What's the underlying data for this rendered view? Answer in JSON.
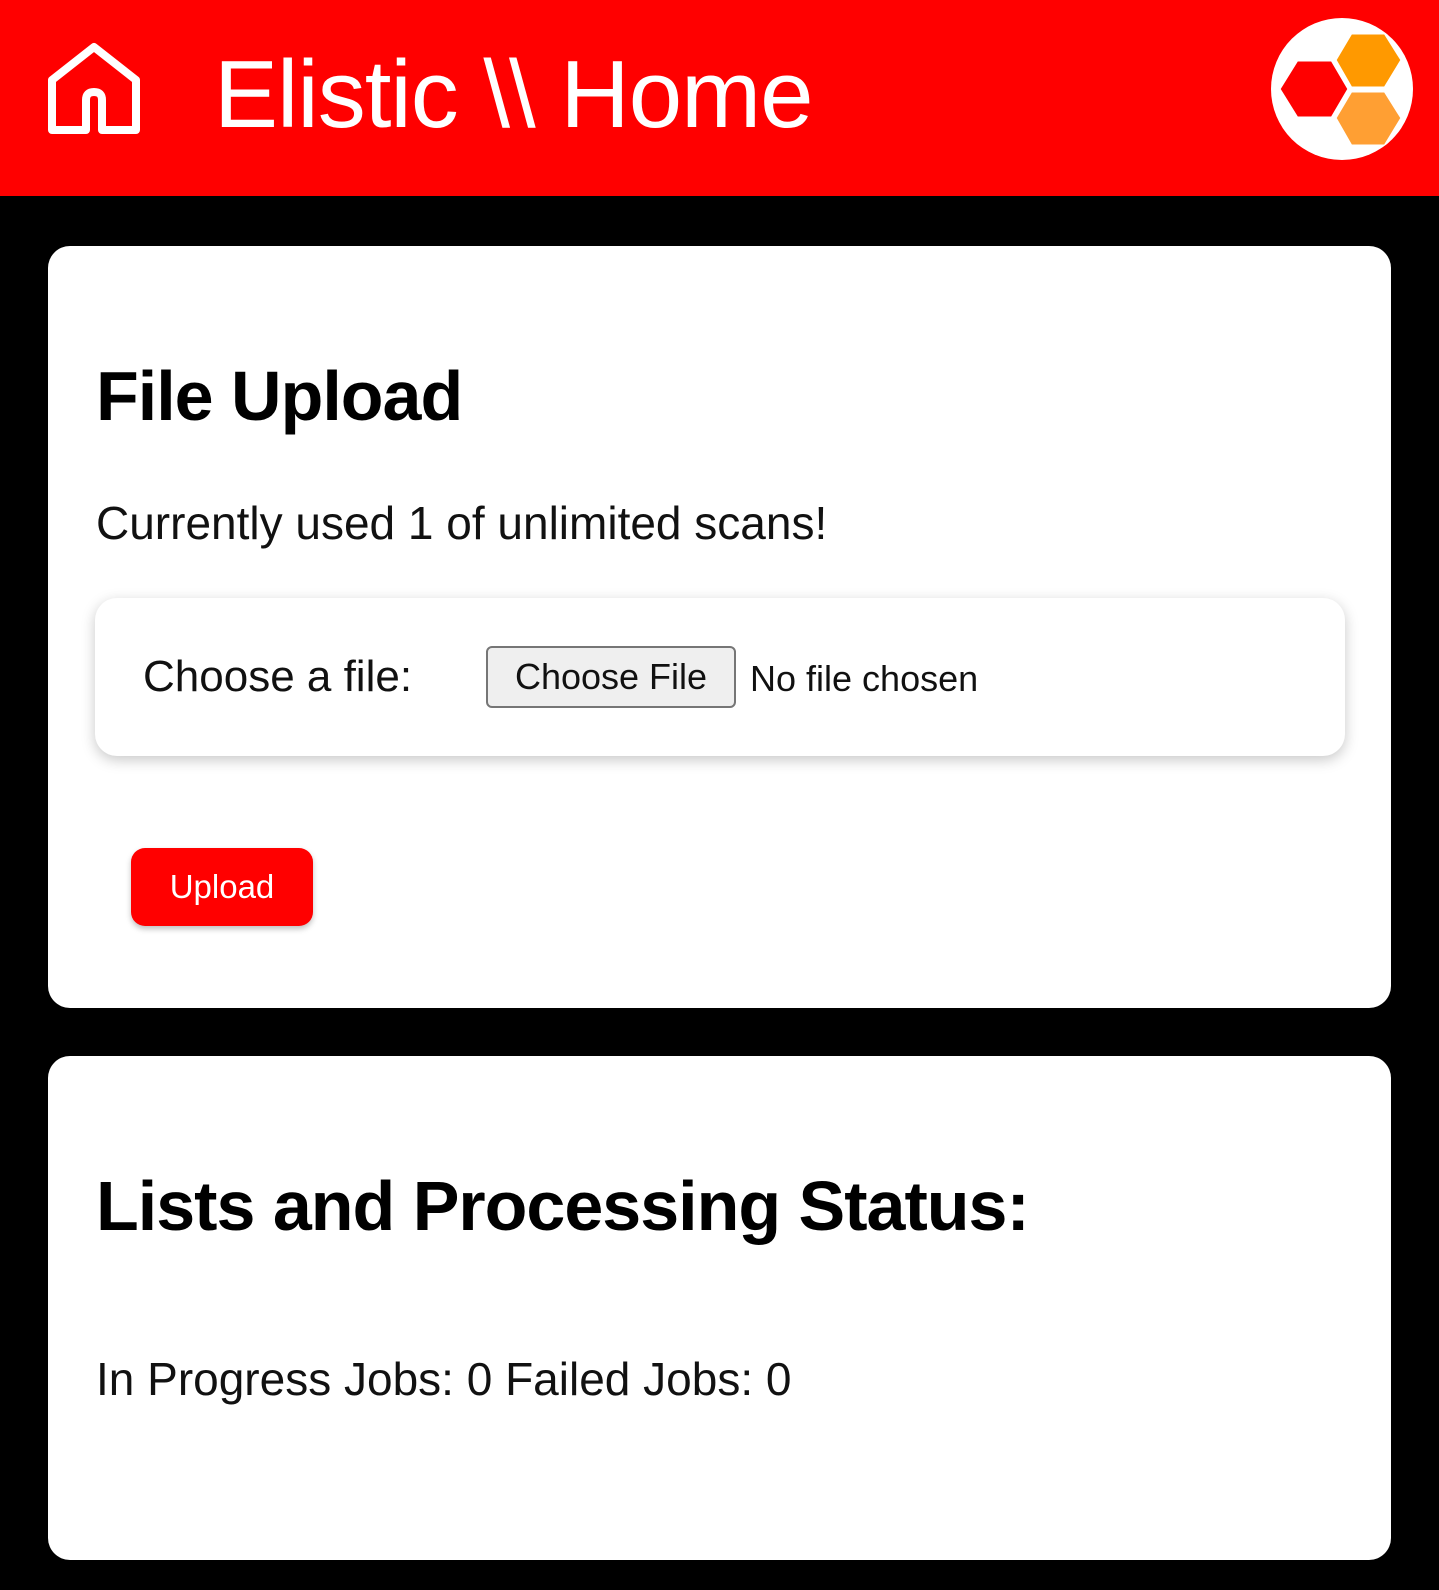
{
  "header": {
    "title": "Elistic \\\\ Home",
    "home_icon": "home-icon",
    "logo_icon": "hexagon-logo-icon",
    "background_color": "#ff0000"
  },
  "upload_card": {
    "title": "File Upload",
    "usage_text": "Currently used 1 of unlimited scans!",
    "file_label": "Choose a file:",
    "choose_button_label": "Choose File",
    "file_status": "No file chosen",
    "upload_button_label": "Upload"
  },
  "status_card": {
    "title": "Lists and Processing Status:",
    "jobs_text": "In Progress Jobs: 0 Failed Jobs: 0"
  },
  "colors": {
    "accent": "#ff0000",
    "logo_red": "#ff0000",
    "logo_orange": "#ff9900",
    "logo_light_orange": "#ff9f33",
    "page_background": "#000000"
  }
}
